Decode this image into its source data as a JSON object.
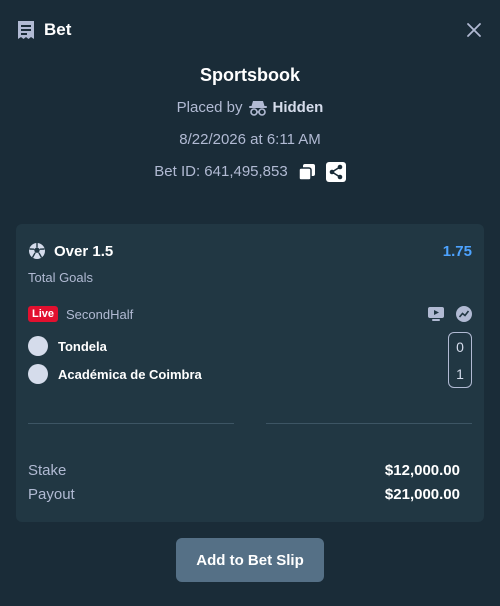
{
  "header": {
    "title": "Bet"
  },
  "info": {
    "title": "Sportsbook",
    "placed_by_label": "Placed by",
    "placed_by_user": "Hidden",
    "datetime": "8/22/2026 at 6:11 AM",
    "bet_id": "Bet ID: 641,495,853"
  },
  "selection": {
    "name": "Over 1.5",
    "odds": "1.75",
    "market": "Total Goals",
    "live_badge": "Live",
    "status": "SecondHalf"
  },
  "teams": [
    {
      "name": "Tondela",
      "score": "0"
    },
    {
      "name": "Académica de Coimbra",
      "score": "1"
    }
  ],
  "summary": {
    "stake_label": "Stake",
    "stake_value": "$12,000.00",
    "payout_label": "Payout",
    "payout_value": "$21,000.00"
  },
  "actions": {
    "add_to_slip": "Add to Bet Slip"
  },
  "icons": {
    "header": "bet-slip-icon",
    "close": "close-icon",
    "placed_by": "incognito-icon",
    "copy": "copy-icon",
    "share": "share-icon",
    "sport": "soccer-ball-icon",
    "stream": "live-stream-icon",
    "stats": "stats-icon"
  },
  "colors": {
    "background": "#1a2c38",
    "card": "#213743",
    "odds": "#4da3ff",
    "live": "#e2102f",
    "button": "#557086"
  }
}
